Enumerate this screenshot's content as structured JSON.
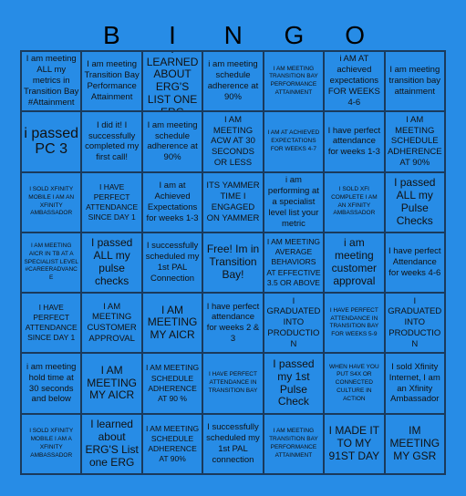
{
  "header": {
    "letters": [
      "B",
      "I",
      "N",
      "G",
      "O"
    ]
  },
  "colors": {
    "background": "#278ce6",
    "grid_line": "#1a3a5c",
    "text": "#111111"
  },
  "grid": {
    "rows": [
      [
        {
          "text": "I am meeting ALL my metrics in Transition Bay #Attainment",
          "size": "md"
        },
        {
          "text": "I am meeting Transition Bay Performance Attainment",
          "size": "md"
        },
        {
          "text": "I LEARNED ABOUT ERG'S LIST ONE ERG",
          "size": "lg"
        },
        {
          "text": "i am meeting schedule adherence at 90%",
          "size": "md"
        },
        {
          "text": "I AM MEETING TRANSITION BAY PERFORMANCE ATTAINMENT",
          "size": "xs"
        },
        {
          "text": "i AM AT achieved expectations FOR WEEKS 4-6",
          "size": "md"
        },
        {
          "text": "I am meeting transition bay attainment",
          "size": "md"
        }
      ],
      [
        {
          "text": "i passed PC 3",
          "size": "xxl"
        },
        {
          "text": "I did it! I successfully completed my first call!",
          "size": "md"
        },
        {
          "text": "I am meeting schedule adherence at 90%",
          "size": "md"
        },
        {
          "text": "I AM MEETING ACW AT 30 SECONDS OR LESS",
          "size": "md"
        },
        {
          "text": "I AM AT ACHIEVED EXPECTATIONS FOR WEEKS 4-7",
          "size": "xs"
        },
        {
          "text": "I have perfect attendance for weeks 1-3",
          "size": "md"
        },
        {
          "text": "I AM MEETING SCHEDULE ADHERENCE AT 90%",
          "size": "md"
        }
      ],
      [
        {
          "text": "I SOLD XFINITY MOBILE I AM AN XFINITY AMBASSADOR",
          "size": "xs"
        },
        {
          "text": "I HAVE PERFECT ATTENDANCE SINCE DAY 1",
          "size": "sm"
        },
        {
          "text": "I am at Achieved Expectations for weeks 1-3",
          "size": "md"
        },
        {
          "text": "ITS YAMMER TIME I ENGAGED ON YAMMER",
          "size": "md"
        },
        {
          "text": "i am performing at a specialist level list your metric",
          "size": "md"
        },
        {
          "text": "I SOLD XFI COMPLETE I AM AN XFINITY AMBASSADOR",
          "size": "xs"
        },
        {
          "text": "I passed ALL my Pulse Checks",
          "size": "lg"
        }
      ],
      [
        {
          "text": "I AM MEETING AICR IN TB AT A SPECIALIST LEVEL #CAREERADVANCE",
          "size": "xs"
        },
        {
          "text": "I passed ALL my pulse checks",
          "size": "lg"
        },
        {
          "text": "I successfully scheduled my 1st PAL Connection",
          "size": "md"
        },
        {
          "text": "Free! Im in Transition Bay!",
          "size": "lg"
        },
        {
          "text": "I AM MEETING AVERAGE BEHAVIORS AT EFFECTIVE 3.5 OR ABOVE",
          "size": "sm"
        },
        {
          "text": "i am meeting customer approval",
          "size": "lg"
        },
        {
          "text": "I have perfect Attendance for weeks 4-6",
          "size": "md"
        }
      ],
      [
        {
          "text": "I HAVE PERFECT ATTENDANCE SINCE DAY 1",
          "size": "sm"
        },
        {
          "text": "I AM MEETING CUSTOMER APPROVAL",
          "size": "md"
        },
        {
          "text": "I AM MEETING MY AICR",
          "size": "lg"
        },
        {
          "text": "I have perfect attendance for weeks 2 & 3",
          "size": "md"
        },
        {
          "text": "I GRADUATED INTO PRODUCTION",
          "size": "md"
        },
        {
          "text": "I HAVE PERFECT ATTENDANCE IN TRANSITION BAY FOR WEEKS 5-9",
          "size": "xs"
        },
        {
          "text": "I GRADUATED INTO PRODUCTION",
          "size": "md"
        }
      ],
      [
        {
          "text": "i am meeting hold time at 30 seconds and below",
          "size": "md"
        },
        {
          "text": "I AM MEETING MY AICR",
          "size": "lg"
        },
        {
          "text": "I AM MEETING SCHEDULE ADHERENCE AT 90 %",
          "size": "sm"
        },
        {
          "text": "I HAVE PERFECT ATTENDANCE IN TRANSITION BAY",
          "size": "xs"
        },
        {
          "text": "I passed my 1st Pulse Check",
          "size": "lg"
        },
        {
          "text": "WHEN HAVE YOU PUT S4X OR CONNECTED CULTURE IN ACTION",
          "size": "xs"
        },
        {
          "text": "I sold Xfinity Internet, I am an Xfinity Ambassador",
          "size": "md"
        }
      ],
      [
        {
          "text": "I SOLD XFINITY MOBILE I AM A XFINITY AMBASSADOR",
          "size": "xs"
        },
        {
          "text": "I learned about ERG'S List one ERG",
          "size": "lg"
        },
        {
          "text": "I AM MEETING SCHEDULE ADHERENCE AT 90%",
          "size": "sm"
        },
        {
          "text": "I successfully scheduled my 1st PAL connection",
          "size": "md"
        },
        {
          "text": "I AM MEETING TRANSITION BAY PERFORMANCE ATTAINMENT",
          "size": "xs"
        },
        {
          "text": "I MADE IT TO MY 91ST DAY",
          "size": "lg"
        },
        {
          "text": "IM MEETING MY GSR",
          "size": "lg"
        }
      ]
    ]
  }
}
